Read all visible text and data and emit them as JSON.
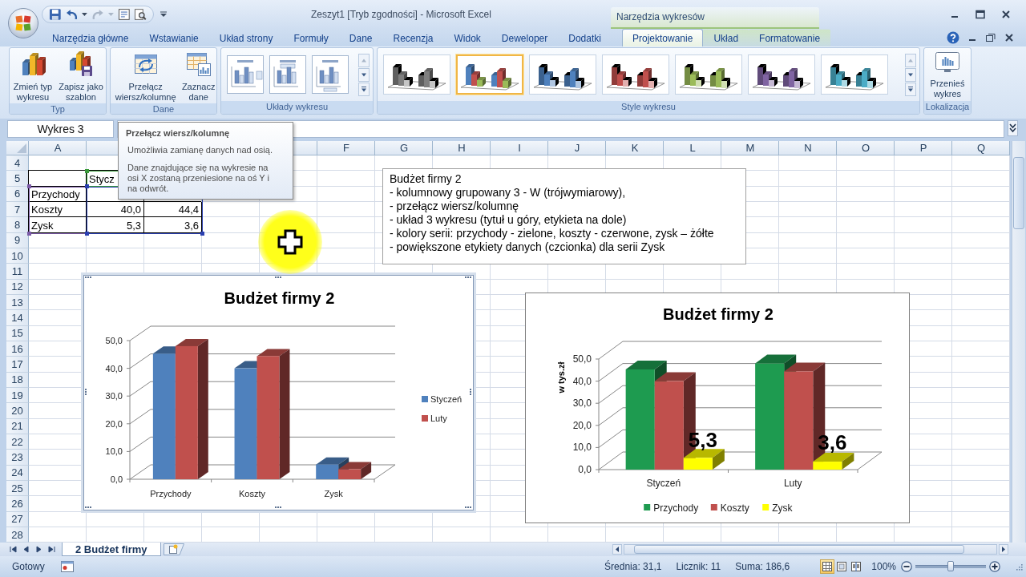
{
  "window": {
    "title": "Zeszyt1 [Tryb zgodności] - Microsoft Excel",
    "context_label": "Narzędzia wykresów"
  },
  "ribbon_tabs": [
    {
      "label": "Narzędzia główne",
      "selected": false,
      "contextual": false
    },
    {
      "label": "Wstawianie",
      "selected": false,
      "contextual": false
    },
    {
      "label": "Układ strony",
      "selected": false,
      "contextual": false
    },
    {
      "label": "Formuły",
      "selected": false,
      "contextual": false
    },
    {
      "label": "Dane",
      "selected": false,
      "contextual": false
    },
    {
      "label": "Recenzja",
      "selected": false,
      "contextual": false
    },
    {
      "label": "Widok",
      "selected": false,
      "contextual": false
    },
    {
      "label": "Deweloper",
      "selected": false,
      "contextual": false
    },
    {
      "label": "Dodatki",
      "selected": false,
      "contextual": false
    },
    {
      "label": "Projektowanie",
      "selected": true,
      "contextual": true
    },
    {
      "label": "Układ",
      "selected": false,
      "contextual": true
    },
    {
      "label": "Formatowanie",
      "selected": false,
      "contextual": true
    }
  ],
  "ribbon_groups": [
    {
      "label": "Typ",
      "kind": "buttons",
      "buttons": [
        {
          "label": "Zmień typ wykresu",
          "kind": "change-type"
        },
        {
          "label": "Zapisz jako szablon",
          "kind": "save-template"
        }
      ]
    },
    {
      "label": "Dane",
      "kind": "buttons",
      "buttons": [
        {
          "label": "Przełącz wiersz/kolumnę",
          "kind": "switch"
        },
        {
          "label": "Zaznacz dane",
          "kind": "select-data"
        }
      ]
    },
    {
      "label": "Układy wykresu",
      "kind": "layouts"
    },
    {
      "label": "Style wykresu",
      "kind": "styles",
      "items": [
        {
          "kind": "mono",
          "color": "#7f7f7f",
          "selected": false
        },
        {
          "kind": "multi",
          "selected": true
        },
        {
          "kind": "mono",
          "color": "#4f81bd",
          "selected": false
        },
        {
          "kind": "mono",
          "color": "#c0504d",
          "selected": false
        },
        {
          "kind": "mono",
          "color": "#9bbb59",
          "selected": false
        },
        {
          "kind": "mono",
          "color": "#8064a2",
          "selected": false
        },
        {
          "kind": "mono",
          "color": "#4bacc6",
          "selected": false
        }
      ]
    },
    {
      "label": "Lokalizacja",
      "kind": "buttons",
      "buttons": [
        {
          "label": "Przenieś wykres",
          "kind": "move-chart"
        }
      ]
    }
  ],
  "formula_bar": {
    "name_box": "Wykres 3"
  },
  "tooltip": {
    "title": "Przełącz wiersz/kolumnę",
    "paragraphs": [
      "Umożliwia zamianę danych nad osią.",
      "Dane znajdujące się na wykresie na osi X zostaną przeniesione na oś Y i na odwrót."
    ]
  },
  "sheet": {
    "columns": [
      "A",
      null,
      null,
      null,
      null,
      "F",
      "G",
      "H",
      "I",
      "J",
      "K",
      "L",
      "M",
      "N",
      "O",
      "P",
      "Q"
    ],
    "rows": [
      {
        "label": "4"
      },
      {
        "label": "5",
        "cells": [
          {
            "kind": "text"
          },
          {
            "kind": "text",
            "value": "Stycz"
          }
        ]
      },
      {
        "label": "6",
        "cells": [
          {
            "kind": "text",
            "value": "Przychody"
          },
          {
            "kind": "number"
          }
        ]
      },
      {
        "label": "7",
        "cells": [
          {
            "kind": "text",
            "value": "Koszty"
          },
          {
            "kind": "number",
            "value": "40,0"
          },
          {
            "kind": "number",
            "value": "44,4"
          }
        ]
      },
      {
        "label": "8",
        "cells": [
          {
            "kind": "text",
            "value": "Zysk"
          },
          {
            "kind": "number",
            "value": "5,3"
          },
          {
            "kind": "number",
            "value": "3,6"
          }
        ]
      },
      {
        "label": "9"
      },
      {
        "label": "10"
      },
      {
        "label": "11"
      },
      {
        "label": "12"
      },
      {
        "label": "13"
      },
      {
        "label": "14"
      },
      {
        "label": "15"
      },
      {
        "label": "16"
      },
      {
        "label": "17"
      },
      {
        "label": "18"
      },
      {
        "label": "19"
      },
      {
        "label": "20"
      },
      {
        "label": "21"
      },
      {
        "label": "22"
      },
      {
        "label": "23"
      },
      {
        "label": "24"
      },
      {
        "label": "25"
      },
      {
        "label": "26"
      },
      {
        "label": "27"
      },
      {
        "label": "28"
      }
    ]
  },
  "text_box": {
    "lines": [
      "Budżet firmy 2",
      "- kolumnowy grupowany 3 - W (trójwymiarowy),",
      "- przełącz wiersz/kolumnę",
      "- układ 3 wykresu (tytuł u góry, etykieta na dole)",
      "- kolory serii: przychody - zielone, koszty - czerwone, zysk – żółte",
      "- powiększone etykiety danych (czcionka) dla serii Zysk"
    ]
  },
  "charts": [
    {
      "selected": true,
      "chart_data": {
        "type": "bar",
        "title": "Budżet firmy 2",
        "categories": [
          "Przychody",
          "Koszty",
          "Zysk"
        ],
        "series": [
          {
            "name": "Styczeń",
            "color": "#4f81bd",
            "values": [
              45.3,
              40.0,
              5.3
            ]
          },
          {
            "name": "Luty",
            "color": "#c0504d",
            "values": [
              48.0,
              44.4,
              3.6
            ]
          }
        ],
        "ylim": [
          0,
          50
        ],
        "yticks": [
          {
            "value": 0,
            "label": "0,0"
          },
          {
            "value": 10,
            "label": "10,0"
          },
          {
            "value": 20,
            "label": "20,0"
          },
          {
            "value": 30,
            "label": "30,0"
          },
          {
            "value": 40,
            "label": "40,0"
          },
          {
            "value": 50,
            "label": "50,0"
          }
        ],
        "grid": true,
        "legend": "right"
      }
    },
    {
      "selected": false,
      "chart_data": {
        "type": "bar",
        "title": "Budżet firmy 2",
        "ylabel": "w tys.zł",
        "categories": [
          "Styczeń",
          "Luty"
        ],
        "series": [
          {
            "name": "Przychody",
            "color": "#1e9b50",
            "values": [
              45.3,
              48.0
            ]
          },
          {
            "name": "Koszty",
            "color": "#c0504d",
            "values": [
              40.0,
              44.4
            ]
          },
          {
            "name": "Zysk",
            "color": "#ffff00",
            "values": [
              5.3,
              3.6
            ],
            "value_labels": [
              "5,3",
              "3,6"
            ]
          }
        ],
        "ylim": [
          0,
          50
        ],
        "yticks": [
          {
            "value": 0,
            "label": "0,0"
          },
          {
            "value": 10,
            "label": "10,0"
          },
          {
            "value": 20,
            "label": "20,0"
          },
          {
            "value": 30,
            "label": "30,0"
          },
          {
            "value": 40,
            "label": "40,0"
          },
          {
            "value": 50,
            "label": "50,0"
          }
        ],
        "grid": true,
        "legend": "bottom"
      }
    }
  ],
  "sheet_tabs": [
    {
      "label": "2 Budżet firmy",
      "selected": true
    }
  ],
  "status_bar": {
    "status": "Gotowy",
    "stats": [
      "Średnia: 31,1",
      "Licznik: 11",
      "Suma: 186,6"
    ],
    "views": [
      {
        "kind": "normal",
        "selected": true
      },
      {
        "kind": "page-layout",
        "selected": false
      },
      {
        "kind": "page-break",
        "selected": false
      }
    ],
    "zoom": {
      "reading": "100%",
      "level": 0.5
    }
  }
}
